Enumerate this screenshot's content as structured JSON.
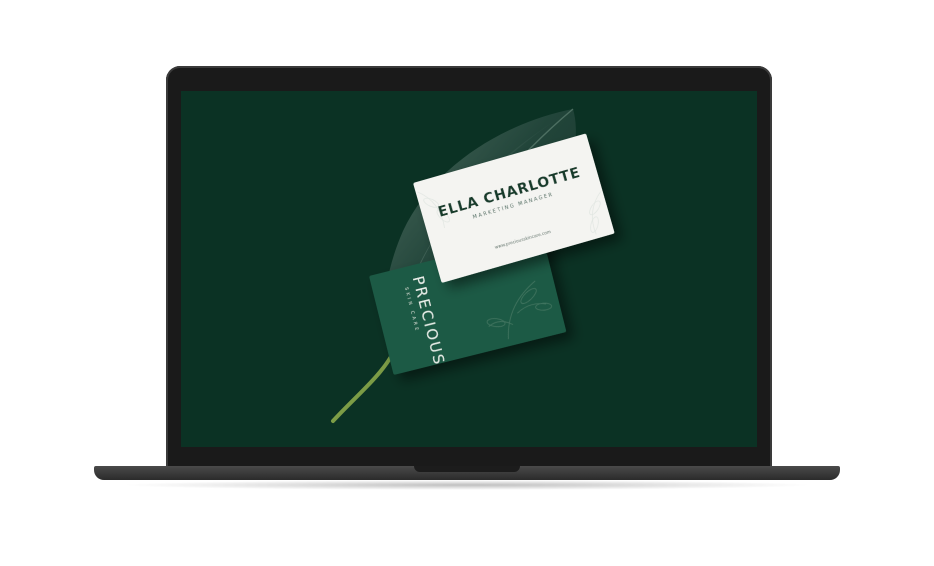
{
  "business_card": {
    "name": "ELLA CHARLOTTE",
    "title": "MARKETING MANAGER",
    "website": "www.preciousskincare.com",
    "brand_name": "PRECIOUS",
    "brand_tagline": "SKIN CARE"
  },
  "colors": {
    "screen_background": "#0b3224",
    "card_dark": "#1f5a44",
    "card_light": "#f4f4f1",
    "leaf": "#26463a"
  }
}
